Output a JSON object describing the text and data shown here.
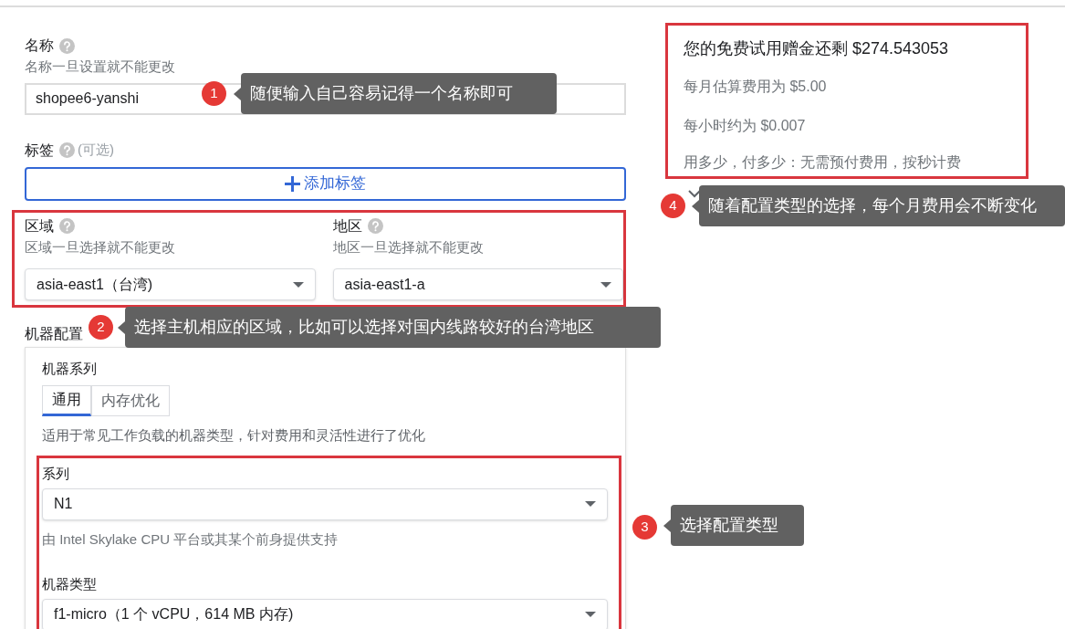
{
  "name": {
    "label": "名称",
    "hint": "名称一旦设置就不能更改",
    "value": "shopee6-yanshi"
  },
  "tags": {
    "label": "标签",
    "optional": "(可选)",
    "button": "添加标签"
  },
  "region": {
    "label": "区域",
    "hint": "区域一旦选择就不能更改",
    "value": "asia-east1（台湾)"
  },
  "zone": {
    "label": "地区",
    "hint": "地区一旦选择就不能更改",
    "value": "asia-east1-a"
  },
  "machine_config": {
    "label": "机器配置",
    "family_label": "机器系列",
    "tabs": [
      {
        "label": "通用",
        "selected": true
      },
      {
        "label": "内存优化",
        "selected": false
      }
    ],
    "family_description": "适用于常见工作负载的机器类型，针对费用和灵活性进行了优化",
    "series": {
      "label": "系列",
      "value": "N1",
      "hint": "由 Intel Skylake CPU 平台或其某个前身提供支持"
    },
    "machine_type": {
      "label": "机器类型",
      "value": "f1-micro（1 个 vCPU，614 MB 内存)"
    }
  },
  "pricing": {
    "title": "您的免费试用赠金还剩 $274.543053",
    "monthly": "每月估算费用为 $5.00",
    "hourly": "每小时约为 $0.007",
    "billing": "用多少，付多少：无需预付费用，按秒计费"
  },
  "annotations": [
    {
      "number": "1",
      "text": "随便输入自己容易记得一个名称即可"
    },
    {
      "number": "4",
      "text": "随着配置类型的选择，每个月费用会不断变化"
    },
    {
      "number": "2",
      "text": "选择主机相应的区域，比如可以选择对国内线路较好的台湾地区"
    },
    {
      "number": "3",
      "text": "选择配置类型"
    }
  ]
}
